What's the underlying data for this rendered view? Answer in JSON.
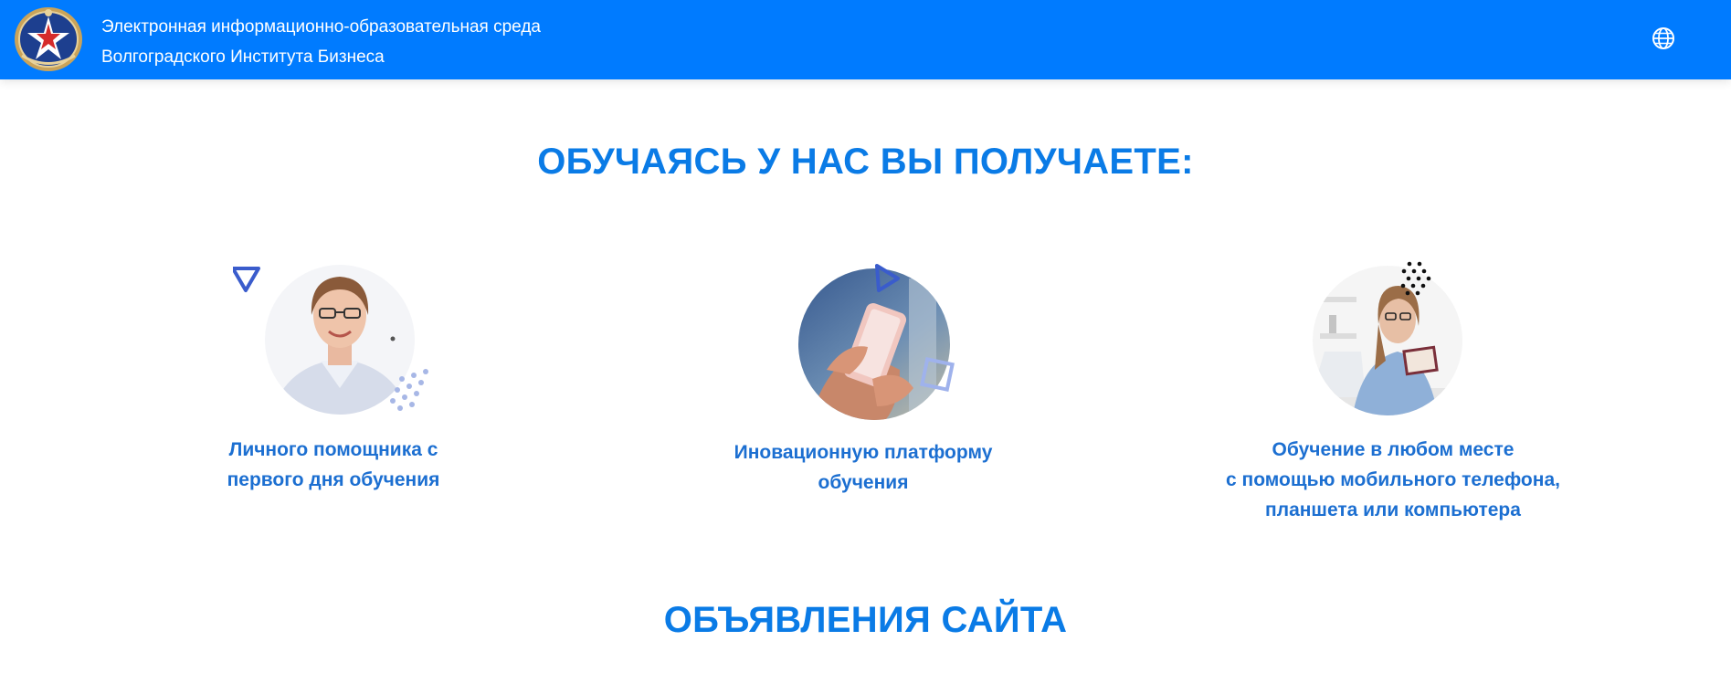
{
  "header": {
    "title_line1": "Электронная информационно-образовательная среда",
    "title_line2": "Волгоградского Института Бизнеса",
    "logo_icon": "institute-emblem-icon",
    "language_icon": "globe-icon",
    "background_color": "#007bff"
  },
  "sections": {
    "benefits_title": "ОБУЧАЯСЬ У НАС ВЫ ПОЛУЧАЕТЕ:",
    "announcements_title": "ОБЪЯВЛЕНИЯ САЙТА"
  },
  "features": [
    {
      "lines": [
        "Личного помощника с",
        "первого дня обучения"
      ],
      "image": "assistant-woman-photo"
    },
    {
      "lines": [
        "Иновационную платформу",
        "обучения"
      ],
      "image": "smartphone-hands-photo"
    },
    {
      "lines": [
        "Обучение в любом месте",
        "с помощью мобильного телефона,",
        "планшета или компьютера"
      ],
      "image": "student-laptop-photo"
    }
  ],
  "colors": {
    "accent": "#0a7be6",
    "caption": "#1c6fd1",
    "deco": "#3a5ccc"
  }
}
